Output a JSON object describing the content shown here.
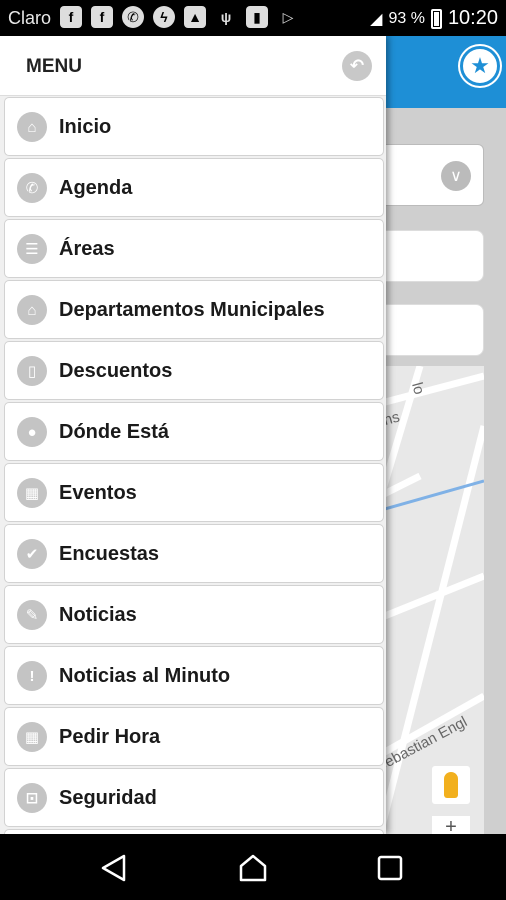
{
  "status_bar": {
    "carrier": "Claro",
    "battery": "93 %",
    "time": "10:20",
    "notification_icons": [
      "facebook-icon",
      "facebook-icon",
      "whatsapp-icon",
      "messenger-icon",
      "image-icon",
      "wifi-hotspot-icon",
      "bookmark-icon",
      "play-store-icon"
    ]
  },
  "drawer": {
    "title": "MENU",
    "items": [
      {
        "label": "Inicio",
        "icon": "home-icon",
        "glyph": "⌂"
      },
      {
        "label": "Agenda",
        "icon": "phone-icon",
        "glyph": "✆"
      },
      {
        "label": "Áreas",
        "icon": "list-icon",
        "glyph": "☰"
      },
      {
        "label": "Departamentos Municipales",
        "icon": "home-icon",
        "glyph": "⌂"
      },
      {
        "label": "Descuentos",
        "icon": "shopping-bag-icon",
        "glyph": "▯"
      },
      {
        "label": "Dónde Está",
        "icon": "map-pin-icon",
        "glyph": "●"
      },
      {
        "label": "Eventos",
        "icon": "calendar-icon",
        "glyph": "▦"
      },
      {
        "label": "Encuestas",
        "icon": "check-icon",
        "glyph": "✔"
      },
      {
        "label": "Noticias",
        "icon": "pencil-icon",
        "glyph": "✎"
      },
      {
        "label": "Noticias al Minuto",
        "icon": "warning-icon",
        "glyph": "!"
      },
      {
        "label": "Pedir Hora",
        "icon": "calendar-icon",
        "glyph": "▦"
      },
      {
        "label": "Seguridad",
        "icon": "lock-icon",
        "glyph": "⊡"
      }
    ]
  },
  "map": {
    "street_labels": [
      "lo",
      "ins",
      "e Sebastian Engl"
    ]
  },
  "colors": {
    "accent": "#1e8fd6",
    "icon_gray": "#c4c4c4"
  }
}
